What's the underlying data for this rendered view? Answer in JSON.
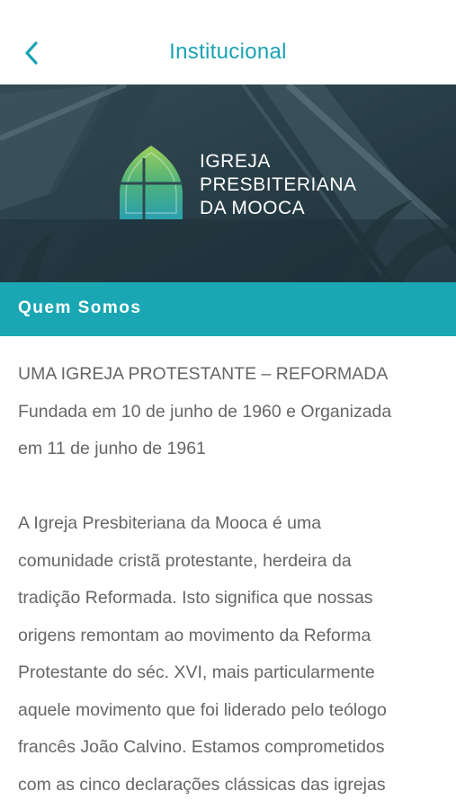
{
  "nav": {
    "back_icon": "chevron-left-icon",
    "title": "Institucional"
  },
  "banner": {
    "logo_line_1": "IGREJA",
    "logo_line_2": "PRESBITERIANA",
    "logo_line_3": "DA MOOCA"
  },
  "section": {
    "title": "Quem Somos"
  },
  "content": {
    "lines_intro": [
      "UMA IGREJA PROTESTANTE – REFORMADA",
      "Fundada em 10 de junho de 1960 e Organizada",
      "em 11 de junho de 1961"
    ],
    "lines_body": [
      "A Igreja Presbiteriana da Mooca é uma",
      "comunidade cristã protestante, herdeira da",
      "tradição Reformada. Isto significa que nossas",
      "origens remontam ao movimento da Reforma",
      "Protestante do séc. XVI, mais particularmente",
      "aquele movimento que foi liderado pelo teólogo",
      "francês João Calvino. Estamos comprometidos",
      "com as cinco declarações clássicas das igrejas"
    ]
  },
  "colors": {
    "accent": "#1aa3b3",
    "section_bar": "#1aa7b3",
    "body_text": "#666666"
  }
}
